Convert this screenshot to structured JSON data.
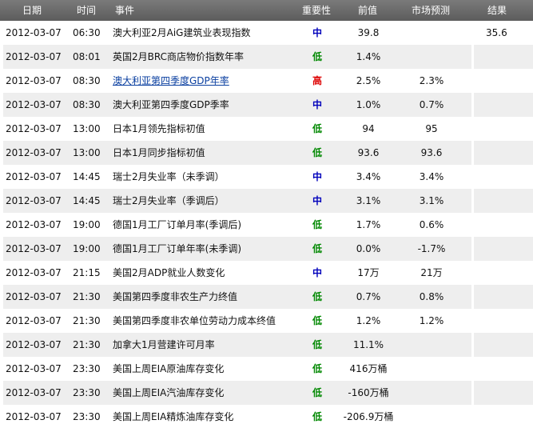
{
  "header": {
    "date": "日期",
    "time": "时间",
    "event": "事件",
    "importance": "重要性",
    "previous": "前值",
    "forecast": "市场预测",
    "result": "结果"
  },
  "colors": {
    "high": "#dd0000",
    "mid": "#0000bb",
    "low": "#008800",
    "link": "#0a3fa0",
    "header_bg": "#666666",
    "alt_row_bg": "#eeeeee"
  },
  "rows": [
    {
      "date": "2012-03-07",
      "time": "06:30",
      "event": "澳大利亚2月AiG建筑业表现指数",
      "importance": "中",
      "level": "mid",
      "previous": "39.8",
      "forecast": "",
      "result": "35.6",
      "link": false
    },
    {
      "date": "2012-03-07",
      "time": "08:01",
      "event": "英国2月BRC商店物价指数年率",
      "importance": "低",
      "level": "low",
      "previous": "1.4%",
      "forecast": "",
      "result": "",
      "link": false
    },
    {
      "date": "2012-03-07",
      "time": "08:30",
      "event": "澳大利亚第四季度GDP年率",
      "importance": "高",
      "level": "high",
      "previous": "2.5%",
      "forecast": "2.3%",
      "result": "",
      "link": true
    },
    {
      "date": "2012-03-07",
      "time": "08:30",
      "event": "澳大利亚第四季度GDP季率",
      "importance": "中",
      "level": "mid",
      "previous": "1.0%",
      "forecast": "0.7%",
      "result": "",
      "link": false
    },
    {
      "date": "2012-03-07",
      "time": "13:00",
      "event": "日本1月领先指标初值",
      "importance": "低",
      "level": "low",
      "previous": "94",
      "forecast": "95",
      "result": "",
      "link": false
    },
    {
      "date": "2012-03-07",
      "time": "13:00",
      "event": "日本1月同步指标初值",
      "importance": "低",
      "level": "low",
      "previous": "93.6",
      "forecast": "93.6",
      "result": "",
      "link": false
    },
    {
      "date": "2012-03-07",
      "time": "14:45",
      "event": "瑞士2月失业率（未季调）",
      "importance": "中",
      "level": "mid",
      "previous": "3.4%",
      "forecast": "3.4%",
      "result": "",
      "link": false
    },
    {
      "date": "2012-03-07",
      "time": "14:45",
      "event": "瑞士2月失业率（季调后）",
      "importance": "中",
      "level": "mid",
      "previous": "3.1%",
      "forecast": "3.1%",
      "result": "",
      "link": false
    },
    {
      "date": "2012-03-07",
      "time": "19:00",
      "event": "德国1月工厂订单月率(季调后)",
      "importance": "低",
      "level": "low",
      "previous": "1.7%",
      "forecast": "0.6%",
      "result": "",
      "link": false
    },
    {
      "date": "2012-03-07",
      "time": "19:00",
      "event": "德国1月工厂订单年率(未季调)",
      "importance": "低",
      "level": "low",
      "previous": "0.0%",
      "forecast": "-1.7%",
      "result": "",
      "link": false
    },
    {
      "date": "2012-03-07",
      "time": "21:15",
      "event": "美国2月ADP就业人数变化",
      "importance": "中",
      "level": "mid",
      "previous": "17万",
      "forecast": "21万",
      "result": "",
      "link": false
    },
    {
      "date": "2012-03-07",
      "time": "21:30",
      "event": "美国第四季度非农生产力终值",
      "importance": "低",
      "level": "low",
      "previous": "0.7%",
      "forecast": "0.8%",
      "result": "",
      "link": false
    },
    {
      "date": "2012-03-07",
      "time": "21:30",
      "event": "美国第四季度非农单位劳动力成本终值",
      "importance": "低",
      "level": "low",
      "previous": "1.2%",
      "forecast": "1.2%",
      "result": "",
      "link": false
    },
    {
      "date": "2012-03-07",
      "time": "21:30",
      "event": "加拿大1月营建许可月率",
      "importance": "低",
      "level": "low",
      "previous": "11.1%",
      "forecast": "",
      "result": "",
      "link": false
    },
    {
      "date": "2012-03-07",
      "time": "23:30",
      "event": "美国上周EIA原油库存变化",
      "importance": "低",
      "level": "low",
      "previous": "416万桶",
      "forecast": "",
      "result": "",
      "link": false
    },
    {
      "date": "2012-03-07",
      "time": "23:30",
      "event": "美国上周EIA汽油库存变化",
      "importance": "低",
      "level": "low",
      "previous": "-160万桶",
      "forecast": "",
      "result": "",
      "link": false
    },
    {
      "date": "2012-03-07",
      "time": "23:30",
      "event": "美国上周EIA精炼油库存变化",
      "importance": "低",
      "level": "low",
      "previous": "-206.9万桶",
      "forecast": "",
      "result": "",
      "link": false
    }
  ]
}
